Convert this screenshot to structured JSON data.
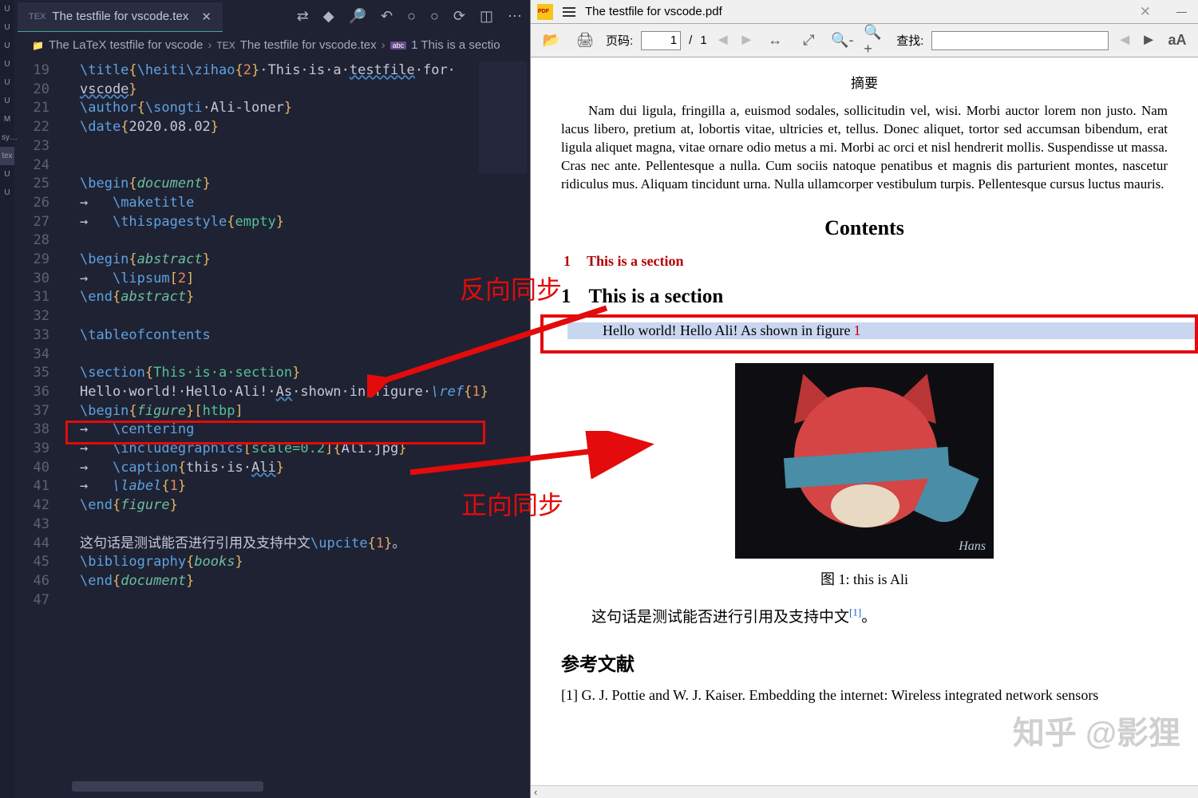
{
  "editor": {
    "tab": {
      "icon": "TEX",
      "title": "The testfile for vscode.tex"
    },
    "breadcrumbs": {
      "b1_icon": "📁",
      "b1": "The LaTeX testfile for vscode",
      "b2_icon": "TEX",
      "b2": "The testfile for vscode.tex",
      "b3_icon": "abc",
      "b3": "1 This is a sectio"
    },
    "code_html": "<span class='tok-cmd'>\\title</span><span class='tok-br'>{</span><span class='tok-cmd'>\\heiti\\zihao</span><span class='tok-br'>{</span><span class='tok-num'>2</span><span class='tok-br'>}</span><span class='tok-txt'>·This·is·a·<span class='underline-wavy'>testfile</span>·for·</span>\n<span class='tok-txt underline-wavy'>vscode</span><span class='tok-br'>}</span>\n<span class='tok-cmd'>\\author</span><span class='tok-br'>{</span><span class='tok-cmd'>\\songti</span><span class='tok-txt'>·Ali-loner</span><span class='tok-br'>}</span>\n<span class='tok-cmd'>\\date</span><span class='tok-br'>{</span><span class='tok-txt'>2020.08.02</span><span class='tok-br'>}</span>\n\n\n<span class='tok-cmd'>\\begin</span><span class='tok-br'>{</span><span class='tok-env'>document</span><span class='tok-br'>}</span>\n<span class='tok-txt'>→   </span><span class='tok-cmd'>\\maketitle</span>\n<span class='tok-txt'>→   </span><span class='tok-cmd'>\\thispagestyle</span><span class='tok-br'>{</span><span class='tok-key'>empty</span><span class='tok-br'>}</span>\n\n<span class='tok-cmd'>\\begin</span><span class='tok-br'>{</span><span class='tok-env'>abstract</span><span class='tok-br'>}</span>\n<span class='tok-txt'>→   </span><span class='tok-cmd'>\\lipsum</span><span class='tok-br'>[</span><span class='tok-num'>2</span><span class='tok-br'>]</span>\n<span class='tok-cmd'>\\end</span><span class='tok-br'>{</span><span class='tok-env'>abstract</span><span class='tok-br'>}</span>\n\n<span class='tok-cmd'>\\tableofcontents</span>\n\n<span class='tok-cmd'>\\section</span><span class='tok-br'>{</span><span class='tok-key'>This·is·a·section</span><span class='tok-br'>}</span>\n<span class='tok-txt'>Hello·world!·Hello·Ali!·<span class='underline-wavy'>As</span>·shown·in·figure·</span><span class='tok-cmd tok-it'>\\ref</span><span class='tok-br'>{</span><span class='tok-num'>1</span><span class='tok-br'>}</span>\n<span class='tok-cmd'>\\begin</span><span class='tok-br'>{</span><span class='tok-env'>figure</span><span class='tok-br'>}[</span><span class='tok-key'>htbp</span><span class='tok-br'>]</span>\n<span class='tok-txt'>→   </span><span class='tok-cmd'>\\centering</span>\n<span class='tok-txt'>→   </span><span class='tok-cmd'>\\includegraphics</span><span class='tok-br'>[</span><span class='tok-key'>scale=0.2</span><span class='tok-br'>]{</span><span class='tok-txt'>Ali.jpg</span><span class='tok-br'>}</span>\n<span class='tok-txt'>→   </span><span class='tok-cmd'>\\caption</span><span class='tok-br'>{</span><span class='tok-txt'>this·is·<span class='underline-wavy'>Ali</span></span><span class='tok-br'>}</span>\n<span class='tok-txt'>→   </span><span class='tok-cmd tok-it'>\\label</span><span class='tok-br'>{</span><span class='tok-num'>1</span><span class='tok-br'>}</span>\n<span class='tok-cmd'>\\end</span><span class='tok-br'>{</span><span class='tok-env'>figure</span><span class='tok-br'>}</span>\n\n<span class='tok-txt'>这句话是测试能否进行引用及支持中文</span><span class='tok-cmd'>\\upcite</span><span class='tok-br'>{</span><span class='tok-num'>1</span><span class='tok-br'>}</span><span class='tok-txt'>。</span>\n<span class='tok-cmd'>\\bibliography</span><span class='tok-br'>{</span><span class='tok-env'>books</span><span class='tok-br'>}</span>\n<span class='tok-cmd'>\\end</span><span class='tok-br'>{</span><span class='tok-env'>document</span><span class='tok-br'>}</span>",
    "line_start": 19,
    "line_end": 47,
    "sidebar_items": [
      "U",
      "U",
      "U",
      "U",
      "U",
      "U",
      "M",
      "sy…",
      "tex",
      "U",
      "U"
    ]
  },
  "viewer": {
    "doc_title": "The testfile for vscode.pdf",
    "page_label": "页码:",
    "page_current": "1",
    "page_sep": "/",
    "page_total": "1",
    "search_label": "查找:"
  },
  "pdf": {
    "abstract_title": "摘要",
    "abstract_body": "Nam dui ligula, fringilla a, euismod sodales, sollicitudin vel, wisi. Morbi auctor lorem non justo. Nam lacus libero, pretium at, lobortis vitae, ultricies et, tellus. Donec aliquet, tortor sed accumsan bibendum, erat ligula aliquet magna, vitae ornare odio metus a mi. Morbi ac orci et nisl hendrerit mollis. Suspendisse ut massa. Cras nec ante. Pellentesque a nulla. Cum sociis natoque penatibus et magnis dis parturient montes, nascetur ridiculus mus. Aliquam tincidunt urna. Nulla ullamcorper vestibulum turpis. Pellentesque cursus luctus mauris.",
    "contents_title": "Contents",
    "toc_num": "1",
    "toc_text": "This is a section",
    "sec_num": "1",
    "sec_title": "This is a section",
    "hello_text": "Hello world! Hello Ali! As shown in figure",
    "hello_fignum": "1",
    "fig_caption": "图 1: this is Ali",
    "fig_signature": "Hans",
    "cn_sentence": "这句话是测试能否进行引用及支持中文",
    "cn_cite": "[1]",
    "cn_period": "。",
    "refs_title": "参考文献",
    "ref1": "[1] G. J. Pottie and W. J. Kaiser. Embedding the internet: Wireless integrated network sensors"
  },
  "annotations": {
    "reverse_sync": "反向同步",
    "forward_sync": "正向同步",
    "watermark": "知乎 @影狸"
  }
}
